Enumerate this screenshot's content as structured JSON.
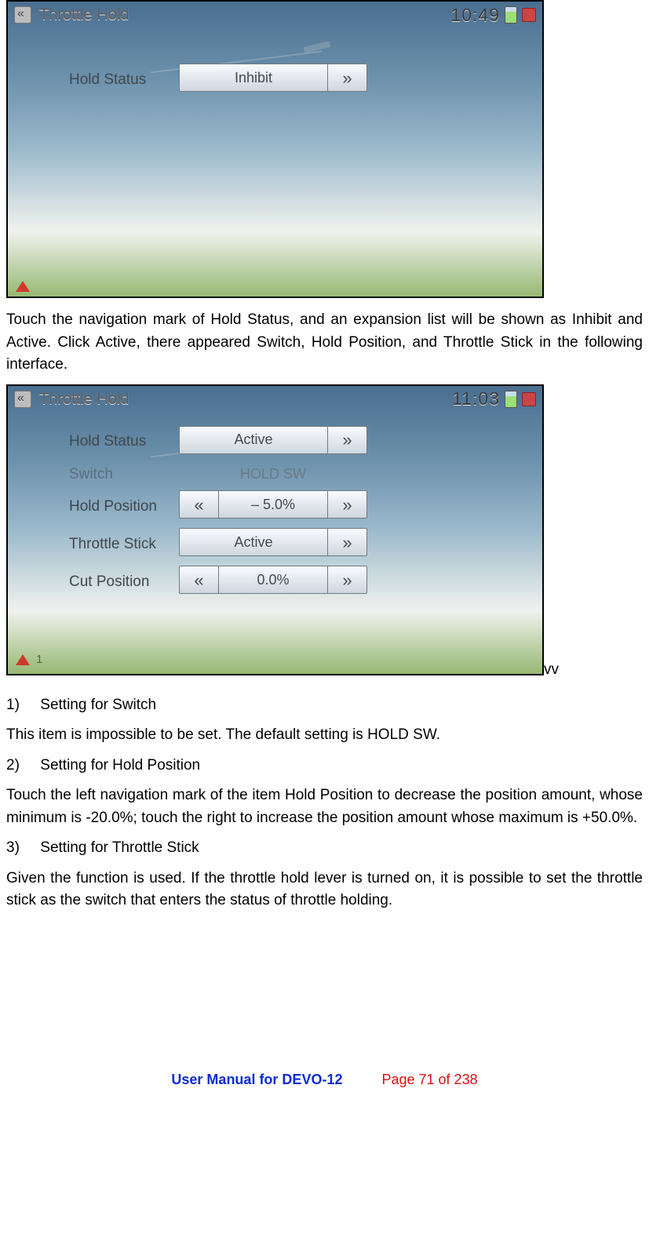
{
  "screenshot1": {
    "title": "Throttle Hold",
    "clock": "10:49",
    "rows": {
      "hold_status": {
        "label": "Hold Status",
        "value": "Inhibit"
      }
    },
    "status_text": ""
  },
  "intro_para": "Touch the navigation mark of Hold Status, and an expansion list will be shown as Inhibit and Active. Click Active, there appeared Switch, Hold Position, and Throttle Stick in the following interface.",
  "screenshot2": {
    "title": "Throttle Hold",
    "clock": "11:03",
    "rows": {
      "hold_status": {
        "label": "Hold Status",
        "value": "Active"
      },
      "switch": {
        "label": "Switch",
        "value": "HOLD SW"
      },
      "hold_position": {
        "label": "Hold Position",
        "value": "– 5.0%"
      },
      "throttle_stick": {
        "label": "Throttle Stick",
        "value": "Active"
      },
      "cut_position": {
        "label": "Cut Position",
        "value": "0.0%"
      }
    },
    "status_text": "1"
  },
  "below_tag": "vv",
  "items": {
    "i1_label": "1)",
    "i1_title": "Setting for Switch",
    "i1_body": "This item is impossible to be set. The default setting is HOLD SW.",
    "i2_label": "2)",
    "i2_title": "Setting for Hold Position",
    "i2_body": "Touch the left navigation mark of the item Hold Position to decrease the position amount, whose minimum is -20.0%; touch the right to increase the position amount whose maximum is +50.0%.",
    "i3_label": "3)",
    "i3_title": "Setting for Throttle Stick",
    "i3_body": "Given the function is used. If the throttle hold lever is turned on, it is possible to set the throttle stick as the switch that enters the status of throttle holding."
  },
  "footer": {
    "manual": "User Manual for DEVO-12",
    "page": "Page 71 of 238"
  },
  "glyphs": {
    "left": "«",
    "right": "»"
  }
}
